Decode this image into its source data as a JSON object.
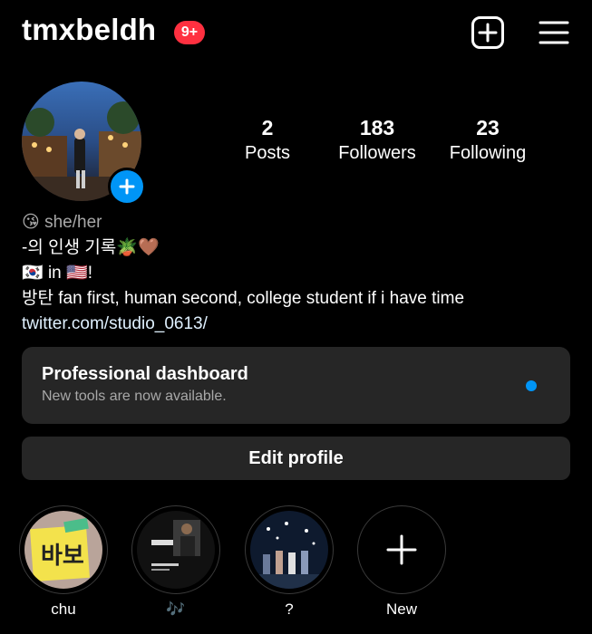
{
  "header": {
    "username": "tmxbeldh",
    "notification_badge": "9+",
    "add_icon": "plus-square-icon",
    "menu_icon": "hamburger-menu-icon"
  },
  "stats": {
    "posts_count": "2",
    "posts_label": "Posts",
    "followers_count": "183",
    "followers_label": "Followers",
    "following_count": "23",
    "following_label": "Following"
  },
  "bio": {
    "pronouns_emoji": "😘",
    "pronouns": "she/her",
    "line1_text": "-의 인생 기록",
    "line1_emojis": "🪴🤎",
    "line2_flag1": "🇰🇷",
    "line2_text": " in ",
    "line2_flag2": "🇺🇸",
    "line2_end": "!",
    "line3": "방탄 fan first, human second, college student if i have time",
    "link": "twitter.com/studio_0613/"
  },
  "dashboard": {
    "title": "Professional dashboard",
    "subtitle": "New tools are now available."
  },
  "edit_profile_label": "Edit profile",
  "highlights": [
    {
      "label": "chu"
    },
    {
      "label": "🎶"
    },
    {
      "label": "?"
    },
    {
      "label": "New"
    }
  ],
  "colors": {
    "background": "#000000",
    "accent_blue": "#0095f6",
    "badge_red": "#ff3040",
    "card_gray": "#262626",
    "secondary_text": "#a8a8a8"
  }
}
